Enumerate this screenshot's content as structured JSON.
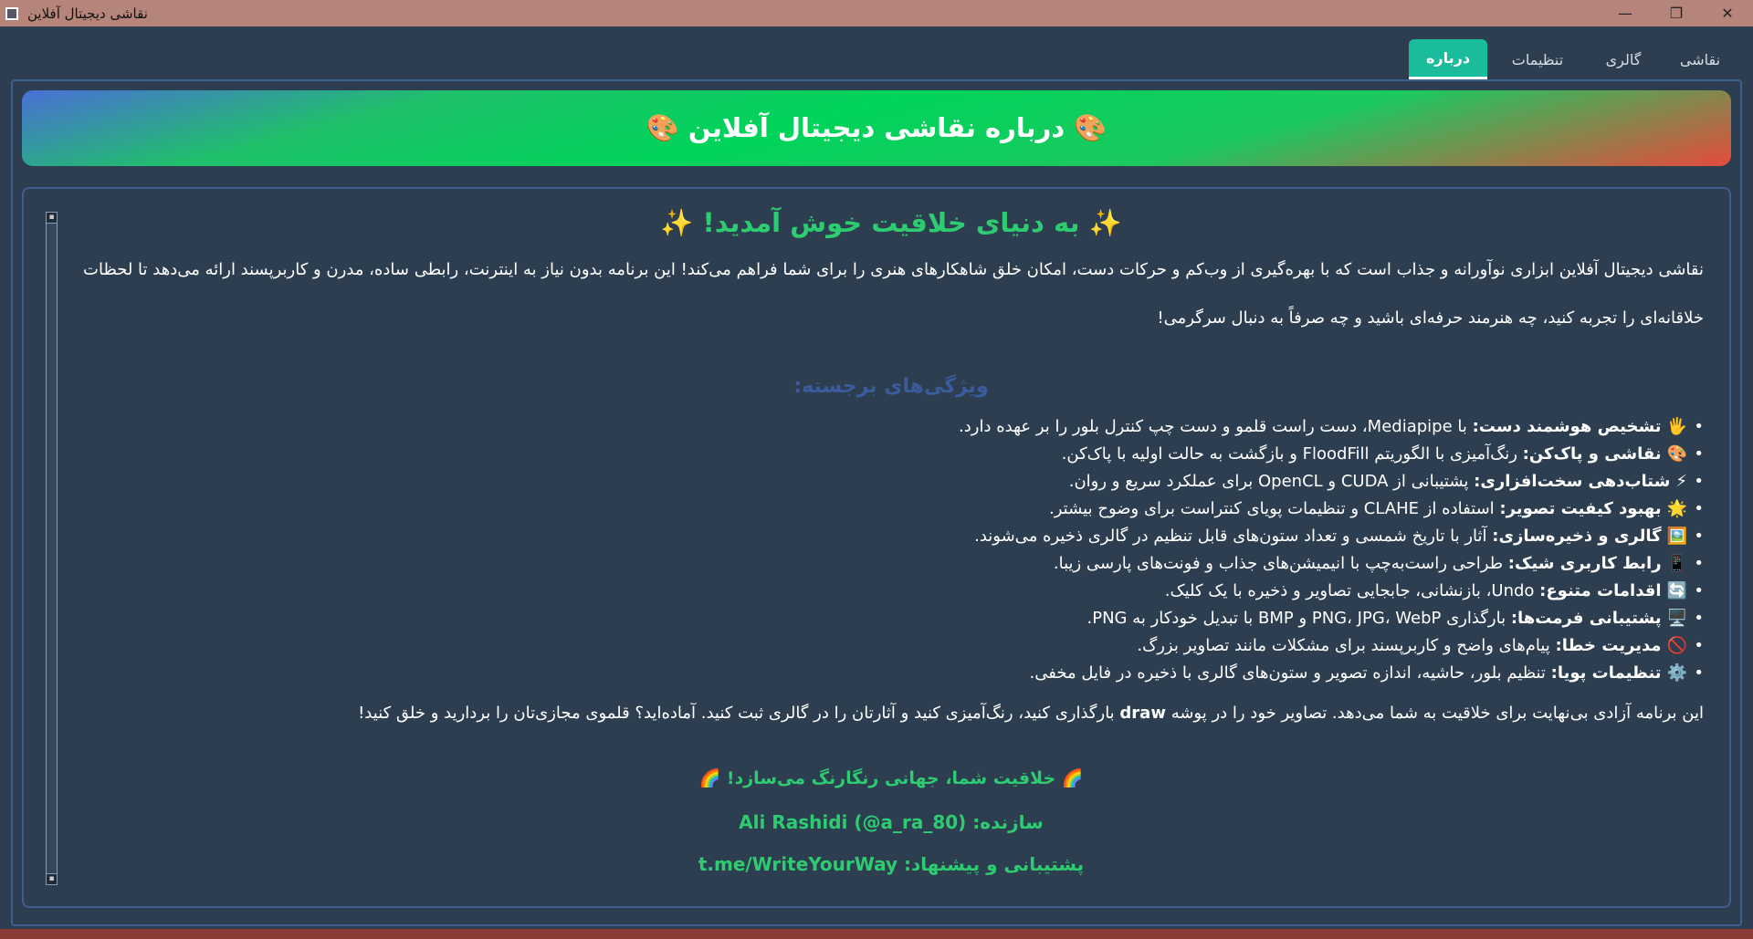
{
  "window": {
    "title": "نقاشی دیجیتال آفلاین",
    "minimize": "—",
    "maximize": "❐",
    "close": "✕"
  },
  "tabs": [
    {
      "label": "نقاشی"
    },
    {
      "label": "گالری"
    },
    {
      "label": "تنظیمات"
    },
    {
      "label": "درباره"
    }
  ],
  "banner": {
    "title": "🎨 درباره نقاشی دیجیتال آفلاین 🎨"
  },
  "content": {
    "welcome": "✨ به دنیای خلاقیت خوش آمدید! ✨",
    "intro": "نقاشی دیجیتال آفلاین ابزاری نوآورانه و جذاب است که با بهره‌گیری از وب‌کم و حرکات دست، امکان خلق شاهکارهای هنری را برای شما فراهم می‌کند! این برنامه بدون نیاز به اینترنت، رابطی ساده، مدرن و کاربرپسند ارائه می‌دهد تا لحظات خلاقانه‌ای را تجربه کنید، چه هنرمند حرفه‌ای باشید و چه صرفاً به دنبال سرگرمی!",
    "features_title": "ویژگی‌های برجسته:",
    "features": [
      {
        "icon": "🖐️",
        "title": "تشخیص هوشمند دست:",
        "text": " با Mediapipe، دست راست قلمو و دست چپ کنترل بلور را بر عهده دارد."
      },
      {
        "icon": "🎨",
        "title": "نقاشی و پاک‌کن:",
        "text": " رنگ‌آمیزی با الگوریتم FloodFill و بازگشت به حالت اولیه با پاک‌کن."
      },
      {
        "icon": "⚡",
        "title": "شتاب‌دهی سخت‌افزاری:",
        "text": " پشتیبانی از CUDA و OpenCL برای عملکرد سریع و روان."
      },
      {
        "icon": "🌟",
        "title": "بهبود کیفیت تصویر:",
        "text": " استفاده از CLAHE و تنظیمات پویای کنتراست برای وضوح بیشتر."
      },
      {
        "icon": "🖼️",
        "title": "گالری و ذخیره‌سازی:",
        "text": " آثار با تاریخ شمسی و تعداد ستون‌های قابل تنظیم در گالری ذخیره می‌شوند."
      },
      {
        "icon": "📱",
        "title": "رابط کاربری شیک:",
        "text": " طراحی راست‌به‌چپ با انیمیشن‌های جذاب و فونت‌های پارسی زیبا."
      },
      {
        "icon": "🔄",
        "title": "اقدامات متنوع:",
        "text": " Undo، بازنشانی، جابجایی تصاویر و ذخیره با یک کلیک."
      },
      {
        "icon": "🖥️",
        "title": "پشتیبانی فرمت‌ها:",
        "text": " بارگذاری PNG، JPG، WebP و BMP با تبدیل خودکار به PNG."
      },
      {
        "icon": "🚫",
        "title": "مدیریت خطا:",
        "text": " پیام‌های واضح و کاربرپسند برای مشکلات مانند تصاویر بزرگ."
      },
      {
        "icon": "⚙️",
        "title": "تنظیمات پویا:",
        "text": " تنظیم بلور، حاشیه، اندازه تصویر و ستون‌های گالری با ذخیره در فایل مخفی."
      }
    ],
    "outro_pre": "این برنامه آزادی بی‌نهایت برای خلاقیت به شما می‌دهد. تصاویر خود را در پوشه ",
    "outro_bold": "draw",
    "outro_post": " بارگذاری کنید، رنگ‌آمیزی کنید و آثارتان را در گالری ثبت کنید. آماده‌اید؟ قلموی مجازی‌تان را بردارید و خلق کنید!",
    "slogan": "🌈 خلاقیت شما، جهانی رنگارنگ می‌سازد! 🌈",
    "maker": "سازنده: Ali Rashidi (@a_ra_80)",
    "support": "پشتیبانی و پیشنهاد: t.me/WriteYourWay"
  },
  "colors": {
    "accent": "#1abc9c",
    "background": "#2c3e50",
    "green_text": "#2ecc71",
    "heading_blue": "#3b5b9c",
    "titlebar": "#b5847a"
  }
}
